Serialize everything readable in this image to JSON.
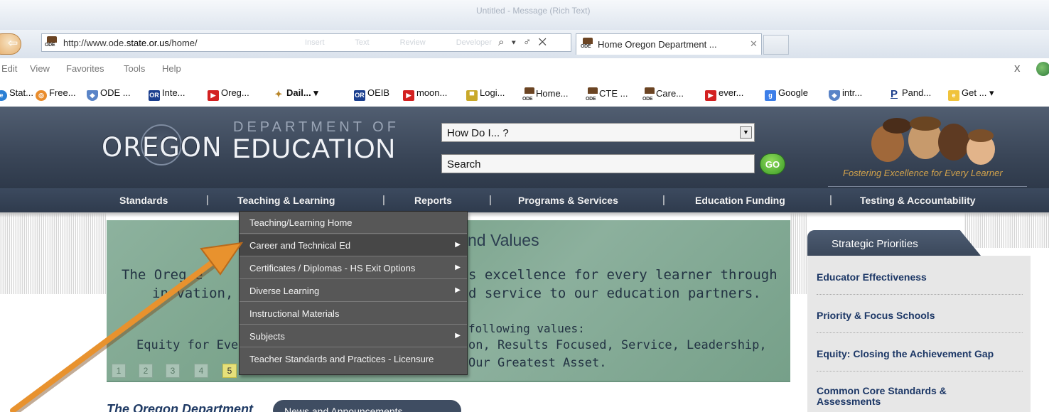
{
  "browser": {
    "window_title": "Untitled - Message (Rich Text)",
    "address": {
      "url_prefix": "http://www.ode.",
      "url_domain": "state.or.us",
      "url_suffix": "/home/",
      "ghost_text": "Insert Text Review Developer",
      "tools": "⌕ ▾ ♂ ✕"
    },
    "active_tab": {
      "label": "Home Oregon Department ...",
      "close": "✕"
    },
    "menu": [
      "Edit",
      "View",
      "Favorites",
      "Tools",
      "Help"
    ],
    "menu_close": "x",
    "favorites": [
      {
        "label": "Stat...",
        "icon": "ie-page-icon",
        "glyph": "e"
      },
      {
        "label": "Free...",
        "icon": "firefox-icon",
        "glyph": "◎"
      },
      {
        "label": "ODE ...",
        "icon": "shield-icon",
        "glyph": "◆"
      },
      {
        "label": "Inte...",
        "icon": "or-icon",
        "glyph": "OR"
      },
      {
        "label": "Oreg...",
        "icon": "youtube-icon",
        "glyph": "▶"
      },
      {
        "label": "Dail... ▾",
        "icon": "dail-icon",
        "glyph": "✦"
      },
      {
        "label": "OEIB",
        "icon": "or-icon",
        "glyph": "OR"
      },
      {
        "label": "moon...",
        "icon": "youtube-icon",
        "glyph": "▶"
      },
      {
        "label": "Logi...",
        "icon": "logi-icon",
        "glyph": "▀"
      },
      {
        "label": "Home...",
        "icon": "ode-icon",
        "glyph": ""
      },
      {
        "label": "CTE ...",
        "icon": "ode-icon",
        "glyph": ""
      },
      {
        "label": "Care...",
        "icon": "ode-icon",
        "glyph": ""
      },
      {
        "label": "ever...",
        "icon": "youtube-icon",
        "glyph": "▶"
      },
      {
        "label": "Google",
        "icon": "google-icon",
        "glyph": "g"
      },
      {
        "label": "intr...",
        "icon": "shield-icon",
        "glyph": "◆"
      },
      {
        "label": "Pand...",
        "icon": "pandora-icon",
        "glyph": "P"
      },
      {
        "label": "Get ... ▾",
        "icon": "get-icon",
        "glyph": "e"
      }
    ]
  },
  "site": {
    "logo_oregon": "OREGON",
    "logo_dept": "DEPARTMENT OF",
    "logo_education": "EDUCATION",
    "howdoi": "How Do I... ?",
    "search": "Search",
    "go": "GO",
    "tagline": "Fostering Excellence for Every Learner",
    "nav": [
      "Standards",
      "Teaching & Learning",
      "Reports",
      "Programs & Services",
      "Education Funding",
      "Testing & Accountability"
    ],
    "nav_sep": "|"
  },
  "dropdown": [
    {
      "label": "Teaching/Learning Home",
      "has_sub": false
    },
    {
      "label": "Career and Technical Ed",
      "has_sub": true
    },
    {
      "label": "Certificates / Diplomas - HS Exit Options",
      "has_sub": true
    },
    {
      "label": "Diverse Learning",
      "has_sub": true
    },
    {
      "label": "Instructional Materials",
      "has_sub": false
    },
    {
      "label": "Subjects",
      "has_sub": true
    },
    {
      "label": "Teacher Standards and Practices - Licensure",
      "has_sub": false
    }
  ],
  "hero": {
    "title_partial": "nd Values",
    "line1a": "The Oreg   e",
    "line1b": "s excellence for every learner through",
    "line2a": "in  vation,",
    "line2b": "d service to our education partners.",
    "line3b": "following values:",
    "line4a": "Equity for Eve",
    "line4b": "on, Results Focused, Service, Leadership,",
    "line5b": "Our Greatest Asset.",
    "pager": [
      "1",
      "2",
      "3",
      "4",
      "5"
    ],
    "pager_active": "5"
  },
  "news": {
    "partial_heading": "The Oregon Department",
    "tab": "News and Announcements"
  },
  "sidebar": {
    "tab": "Strategic Priorities",
    "items": [
      "Educator Effectiveness",
      "Priority & Focus Schools",
      "Equity: Closing the Achievement Gap",
      "Common Core Standards &",
      "Assessments"
    ]
  },
  "colors": {
    "header": "#3a4658",
    "dropdown": "#575757",
    "hero": "#7aa38b",
    "arrow": "#e8922e",
    "link": "#1c3766"
  }
}
